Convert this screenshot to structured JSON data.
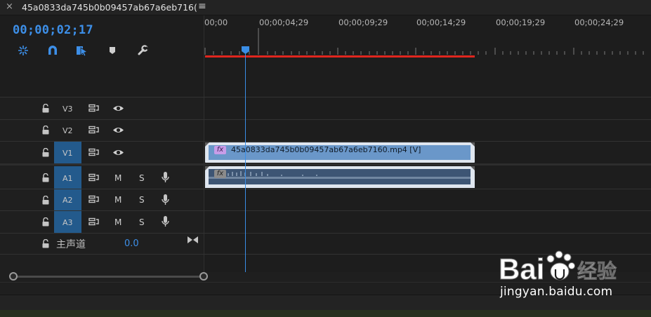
{
  "tab": {
    "close_glyph": "×",
    "title": "45a0833da745b0b09457ab67a6eb716(",
    "menu_glyph": "≡"
  },
  "timeline": {
    "timecode": "00;00;02;17",
    "ruler_ticks": [
      "00;00",
      "00;00;04;29",
      "00;00;09;29",
      "00;00;14;29",
      "00;00;19;29",
      "00;00;24;29"
    ],
    "tools": [
      "snap-insert-icon",
      "magnet-icon",
      "linked-selection-icon",
      "marker-icon",
      "wrench-icon"
    ]
  },
  "tracks": {
    "v3": {
      "label": "V3"
    },
    "v2": {
      "label": "V2"
    },
    "v1": {
      "label": "V1"
    },
    "a1": {
      "label": "A1",
      "mute": "M",
      "solo": "S"
    },
    "a2": {
      "label": "A2",
      "mute": "M",
      "solo": "S"
    },
    "a3": {
      "label": "A3",
      "mute": "M",
      "solo": "S"
    },
    "master": {
      "label": "主声道",
      "value": "0.0"
    }
  },
  "clips": {
    "v1": {
      "fx": "fx",
      "name": "45a0833da745b0b09457ab67a6eb7160.mp4 [V]"
    },
    "a1": {
      "fx": "fx"
    }
  },
  "watermark": {
    "brand": "Bai",
    "brand_cn": "经验",
    "url": "jingyan.baidu.com"
  },
  "colors": {
    "accent": "#3d8fe8",
    "target_track": "#235a8c",
    "work_area": "#e0261e",
    "video_clip": "#6a97c9",
    "audio_clip": "#3d5574"
  }
}
